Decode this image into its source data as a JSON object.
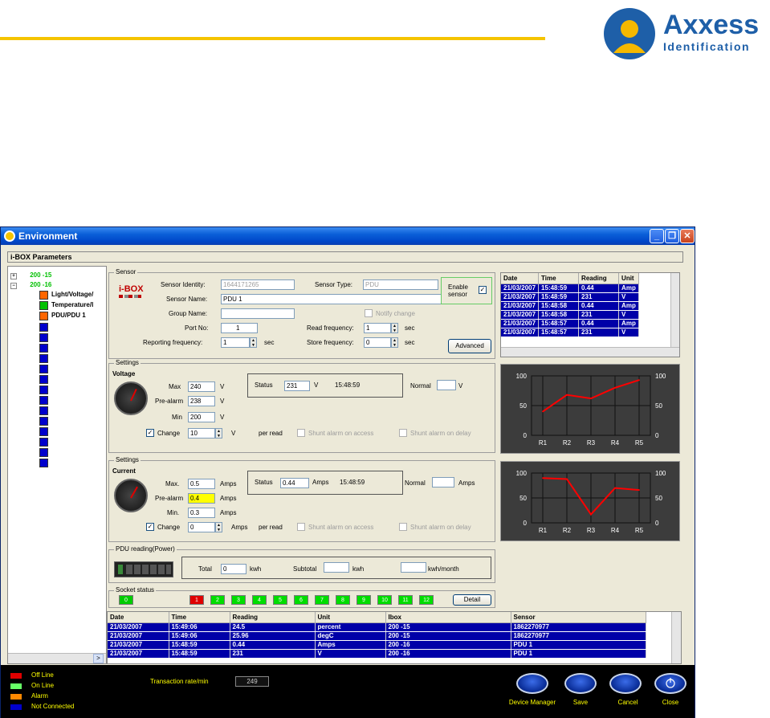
{
  "logo": {
    "word": "Axxess",
    "sub": "Identification"
  },
  "window": {
    "title": "Environment",
    "buttons": {
      "minimize": "_",
      "restore": "❐",
      "close": "✕"
    },
    "ibox_bar": "i-BOX Parameters"
  },
  "tree": {
    "items": [
      {
        "label": "200 -15",
        "color": "#00c000"
      },
      {
        "label": "200 -16",
        "color": "#00c000"
      },
      {
        "label": "Light/Voltage/",
        "node": "#ff6600"
      },
      {
        "label": "Temperature/l",
        "node": "#00c000"
      },
      {
        "label": "PDU/PDU 1",
        "node": "#ff6600"
      }
    ],
    "empty_nodes": 14
  },
  "sensor": {
    "group_title": "Sensor",
    "logo_text": "i-BOX",
    "identity_label": "Sensor Identity:",
    "identity_value": "1644171265",
    "type_label": "Sensor Type:",
    "type_value": "PDU",
    "name_label": "Sensor Name:",
    "name_value": "PDU 1",
    "group_label": "Group Name:",
    "group_value": "",
    "notify_label": "Notify change",
    "port_label": "Port No:",
    "port_value": "1",
    "read_freq_label": "Read frequency:",
    "read_freq_value": "1",
    "sec": "sec",
    "report_freq_label": "Reporting frequency:",
    "report_freq_value": "1",
    "store_freq_label": "Store frequency:",
    "store_freq_value": "0",
    "enable_label": "Enable sensor",
    "advanced": "Advanced"
  },
  "reading_table": {
    "headers": [
      "Date",
      "Time",
      "Reading",
      "Unit"
    ],
    "rows": [
      [
        "21/03/2007",
        "15:48:59",
        "0.44",
        "Amp"
      ],
      [
        "21/03/2007",
        "15:48:59",
        "231",
        "V"
      ],
      [
        "21/03/2007",
        "15:48:58",
        "0.44",
        "Amp"
      ],
      [
        "21/03/2007",
        "15:48:58",
        "231",
        "V"
      ],
      [
        "21/03/2007",
        "15:48:57",
        "0.44",
        "Amp"
      ],
      [
        "21/03/2007",
        "15:48:57",
        "231",
        "V"
      ]
    ]
  },
  "voltage": {
    "group_title": "Settings",
    "heading": "Voltage",
    "max_label": "Max",
    "max_value": "240",
    "unit": "V",
    "prealarm_label": "Pre-alarm",
    "prealarm_value": "238",
    "min_label": "Min",
    "min_value": "200",
    "change_label": "Change",
    "change_value": "10",
    "per_read": "per read",
    "shunt_access": "Shunt alarm  on access",
    "shunt_delay": "Shunt alarm  on delay",
    "status_label": "Status",
    "status_value": "231",
    "status_time": "15:48:59",
    "normal_label": "Normal",
    "normal_value": ""
  },
  "current": {
    "group_title": "Settings",
    "heading": "Current",
    "max_label": "Max.",
    "max_value": "0.5",
    "unit": "Amps",
    "prealarm_label": "Pre-alarm",
    "prealarm_value": "0.4",
    "min_label": "Min.",
    "min_value": "0.3",
    "change_label": "Change",
    "change_value": "0",
    "per_read": "per read",
    "shunt_access": "Shunt alarm  on access",
    "shunt_delay": "Shunt alarm  on delay",
    "status_label": "Status",
    "status_value": "0.44",
    "status_time": "15:48:59",
    "normal_label": "Normal",
    "normal_value": ""
  },
  "pdu": {
    "group_title": "PDU reading(Power)",
    "total_label": "Total",
    "total_value": "0",
    "kwh": "kwh",
    "subtotal_label": "Subtotal",
    "subtotal_value": "",
    "month_value": "",
    "month_unit": "kwh/month"
  },
  "sockets": {
    "group_title": "Socket status",
    "first": {
      "label": "0",
      "color": "#00cc00"
    },
    "items": [
      {
        "label": "1",
        "color": "#e00000"
      },
      {
        "label": "2",
        "color": "#00dd00"
      },
      {
        "label": "3",
        "color": "#00dd00"
      },
      {
        "label": "4",
        "color": "#00dd00"
      },
      {
        "label": "5",
        "color": "#00dd00"
      },
      {
        "label": "6",
        "color": "#00dd00"
      },
      {
        "label": "7",
        "color": "#00dd00"
      },
      {
        "label": "8",
        "color": "#00dd00"
      },
      {
        "label": "9",
        "color": "#00dd00"
      },
      {
        "label": "10",
        "color": "#00dd00"
      },
      {
        "label": "11",
        "color": "#00dd00"
      },
      {
        "label": "12",
        "color": "#00dd00"
      }
    ],
    "detail": "Detail"
  },
  "log_table": {
    "headers": [
      "Date",
      "Time",
      "Reading",
      "Unit",
      "Ibox",
      "Sensor"
    ],
    "rows": [
      [
        "21/03/2007",
        "15:49:06",
        "24.5",
        "percent",
        "200 -15",
        "1862270977"
      ],
      [
        "21/03/2007",
        "15:49:06",
        "25.96",
        "degC",
        "200 -15",
        "1862270977"
      ],
      [
        "21/03/2007",
        "15:48:59",
        "0.44",
        "Amps",
        "200 -16",
        "PDU 1"
      ],
      [
        "21/03/2007",
        "15:48:59",
        "231",
        "V",
        "200 -16",
        "PDU 1"
      ]
    ]
  },
  "legend": [
    {
      "label": "Off Line",
      "color": "#e00000"
    },
    {
      "label": "On Line",
      "color": "#66ff66"
    },
    {
      "label": "Alarm",
      "color": "#ff8800"
    },
    {
      "label": "Not Connected",
      "color": "#0000cc"
    }
  ],
  "transaction": {
    "label": "Transaction rate/min",
    "value": "249"
  },
  "bottom_buttons": {
    "device_manager": "Device Manager",
    "save": "Save",
    "cancel": "Cancel",
    "close": "Close"
  },
  "chart_data": [
    {
      "type": "line",
      "categories": [
        "R1",
        "R2",
        "R3",
        "R4",
        "R5"
      ],
      "series": [
        {
          "values": [
            40,
            68,
            62,
            80,
            93
          ],
          "color": "#ff0000"
        }
      ],
      "ylim": [
        0,
        100
      ],
      "yticks": [
        0,
        50,
        100
      ],
      "grid": true
    },
    {
      "type": "line",
      "categories": [
        "R1",
        "R2",
        "R3",
        "R4",
        "R5"
      ],
      "series": [
        {
          "values": [
            90,
            88,
            17,
            70,
            66
          ],
          "color": "#ff0000"
        }
      ],
      "ylim": [
        0,
        100
      ],
      "yticks": [
        0,
        50,
        100
      ],
      "grid": true
    }
  ]
}
